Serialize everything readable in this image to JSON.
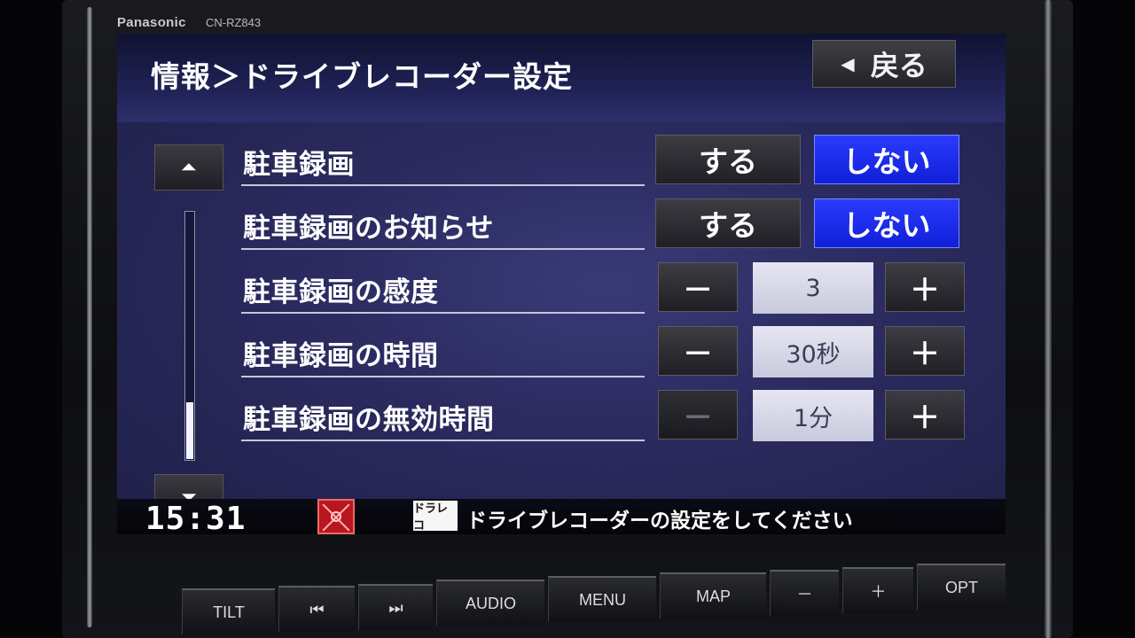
{
  "device": {
    "brand": "Panasonic",
    "model": "CN-RZ843"
  },
  "header": {
    "title": "情報＞ドライブレコーダー設定",
    "back_label": "戻る"
  },
  "scroll": {
    "position": 0.85
  },
  "rows": [
    {
      "label": "駐車録画",
      "type": "toggle",
      "options": [
        "する",
        "しない"
      ],
      "selected": "しない"
    },
    {
      "label": "駐車録画のお知らせ",
      "type": "toggle",
      "options": [
        "する",
        "しない"
      ],
      "selected": "しない"
    },
    {
      "label": "駐車録画の感度",
      "type": "stepper",
      "value": "3",
      "minus": "－",
      "plus": "＋",
      "minus_enabled": true
    },
    {
      "label": "駐車録画の時間",
      "type": "stepper",
      "value": "30秒",
      "minus": "－",
      "plus": "＋",
      "minus_enabled": true
    },
    {
      "label": "駐車録画の無効時間",
      "type": "stepper",
      "value": "1分",
      "minus": "－",
      "plus": "＋",
      "minus_enabled": false
    }
  ],
  "status": {
    "clock": "15:31",
    "icon_label": "ドラレコ",
    "message": "ドライブレコーダーの設定をしてください"
  },
  "hardware_buttons": [
    "TILT",
    "⏮",
    "⏭",
    "AUDIO",
    "MENU",
    "MAP",
    "－",
    "＋",
    "OPT"
  ],
  "colors": {
    "accent_selected": "#1a2ef0",
    "screen_bg": "#2a2a5e",
    "value_box": "#d8d8e8"
  }
}
